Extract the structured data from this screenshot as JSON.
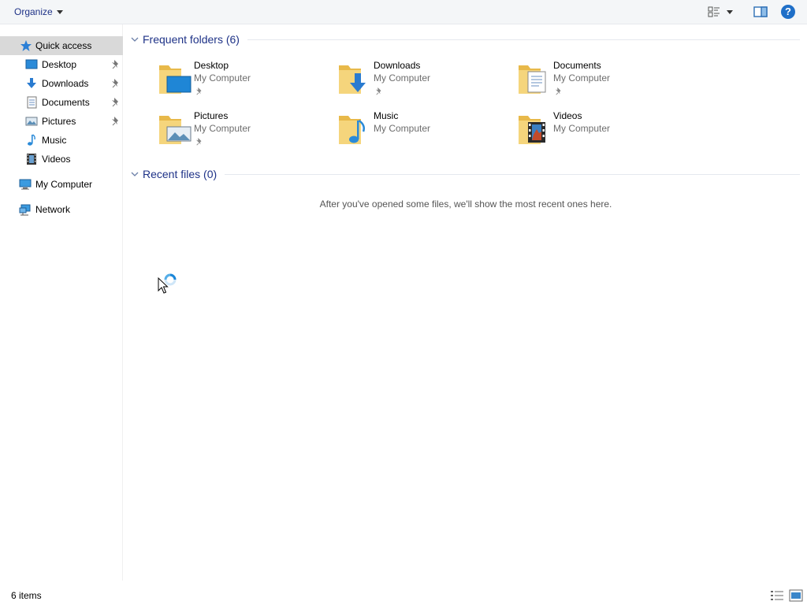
{
  "toolbar": {
    "organize_label": "Organize",
    "help_label": "?"
  },
  "nav": {
    "quick_access": "Quick access",
    "items": [
      {
        "label": "Desktop",
        "icon": "desktop-icon",
        "pinned": true
      },
      {
        "label": "Downloads",
        "icon": "downloads-icon",
        "pinned": true
      },
      {
        "label": "Documents",
        "icon": "documents-icon",
        "pinned": true
      },
      {
        "label": "Pictures",
        "icon": "pictures-icon",
        "pinned": true
      },
      {
        "label": "Music",
        "icon": "music-icon",
        "pinned": false
      },
      {
        "label": "Videos",
        "icon": "videos-icon",
        "pinned": false
      }
    ],
    "my_computer": "My Computer",
    "network": "Network"
  },
  "frequent": {
    "title": "Frequent folders (6)",
    "folders": [
      {
        "name": "Desktop",
        "location": "My Computer",
        "pinned": true
      },
      {
        "name": "Downloads",
        "location": "My Computer",
        "pinned": true
      },
      {
        "name": "Documents",
        "location": "My Computer",
        "pinned": true
      },
      {
        "name": "Pictures",
        "location": "My Computer",
        "pinned": true
      },
      {
        "name": "Music",
        "location": "My Computer",
        "pinned": false
      },
      {
        "name": "Videos",
        "location": "My Computer",
        "pinned": false
      }
    ]
  },
  "recent": {
    "title": "Recent files (0)",
    "empty_message": "After you've opened some files, we'll show the most recent ones here."
  },
  "status": {
    "item_count": "6 items"
  },
  "colors": {
    "accent_text": "#1e3287",
    "folder_yellow": "#f2cf6b",
    "selection_bg": "#d9d9d9"
  }
}
